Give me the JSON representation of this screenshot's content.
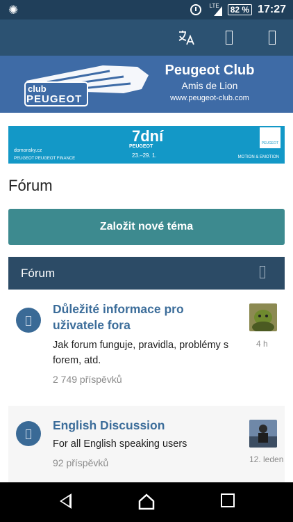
{
  "status_bar": {
    "network": "LTE",
    "battery": "82 %",
    "time": "17:27"
  },
  "banner": {
    "logo_club": "club",
    "logo_peugeot": "PEUGEOT",
    "title": "Peugeot Club",
    "subtitle": "Amis de Lion",
    "url": "www.peugeot-club.com"
  },
  "ad": {
    "left_text": "domonsky.cz",
    "left_small": "PEUGEOT   PEUGEOT FINANCE",
    "headline": "7dní",
    "brand": "PEUGEOT",
    "dates": "23.–29. 1.",
    "slogan": "MOTION & EMOTION",
    "logo_text": "PEUGEOT"
  },
  "page": {
    "title": "Fórum",
    "new_topic_label": "Založit nové téma"
  },
  "forum_section": {
    "header": "Fórum",
    "topics": [
      {
        "title": "Důležité informace pro uživatele fora",
        "description": "Jak forum funguje, pravidla, problémy s forem, atd.",
        "posts": "2 749 příspěvků",
        "last_post": "4 h"
      },
      {
        "title": "English Discussion",
        "description": "For all English speaking users",
        "posts": "92 příspěvků",
        "last_post": "12. leden"
      }
    ]
  },
  "colors": {
    "status_bar": "#203f5a",
    "top_bar": "#2c5272",
    "banner": "#3e6ba6",
    "ad_background": "#1398c7",
    "primary_button": "#3d8a8f",
    "section_header": "#2c4b66",
    "topic_title": "#3c6d9a"
  }
}
